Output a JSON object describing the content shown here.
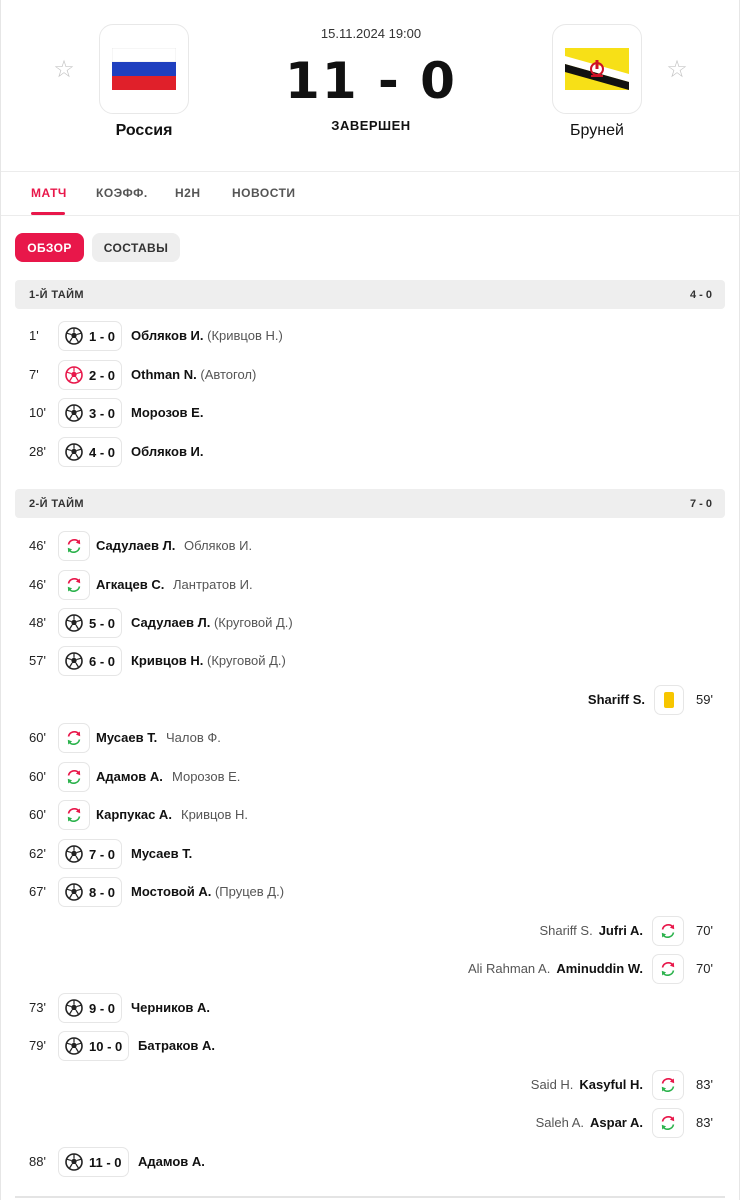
{
  "match": {
    "date": "15.11.2024 19:00",
    "score": "11 - 0",
    "status": "ЗАВЕРШЕН",
    "home": {
      "name": "Россия"
    },
    "away": {
      "name": "Бруней"
    }
  },
  "tabs": [
    {
      "label": "МАТЧ",
      "active": true
    },
    {
      "label": "КОЭФФ.",
      "active": false
    },
    {
      "label": "H2H",
      "active": false
    },
    {
      "label": "НОВОСТИ",
      "active": false
    }
  ],
  "pills": [
    {
      "label": "ОБЗОР",
      "active": true
    },
    {
      "label": "СОСТАВЫ",
      "active": false
    }
  ],
  "halves": [
    {
      "label": "1-Й ТАЙМ",
      "score": "4 - 0"
    },
    {
      "label": "2-Й ТАЙМ",
      "score": "7 - 0"
    }
  ],
  "events": [
    {
      "minute": "1'",
      "type": "goal",
      "side": "home",
      "score": "1 - 0",
      "player": "Обляков И.",
      "assist": "(Кривцов Н.)"
    },
    {
      "minute": "7'",
      "type": "own-goal",
      "side": "home",
      "score": "2 - 0",
      "player": "Othman N.",
      "assist": "(Автогол)"
    },
    {
      "minute": "10'",
      "type": "goal",
      "side": "home",
      "score": "3 - 0",
      "player": "Морозов Е.",
      "assist": ""
    },
    {
      "minute": "28'",
      "type": "goal",
      "side": "home",
      "score": "4 - 0",
      "player": "Обляков И.",
      "assist": ""
    },
    {
      "minute": "46'",
      "type": "sub",
      "side": "home",
      "player": "Садулаев Л.",
      "out": "Обляков И."
    },
    {
      "minute": "46'",
      "type": "sub",
      "side": "home",
      "player": "Агкацев С.",
      "out": "Лантратов И."
    },
    {
      "minute": "48'",
      "type": "goal",
      "side": "home",
      "score": "5 - 0",
      "player": "Садулаев Л.",
      "assist": "(Круговой Д.)"
    },
    {
      "minute": "57'",
      "type": "goal",
      "side": "home",
      "score": "6 - 0",
      "player": "Кривцов Н.",
      "assist": "(Круговой Д.)"
    },
    {
      "minute": "59'",
      "type": "yellow",
      "side": "away",
      "player": "Shariff S.",
      "out": ""
    },
    {
      "minute": "60'",
      "type": "sub",
      "side": "home",
      "player": "Мусаев Т.",
      "out": "Чалов Ф."
    },
    {
      "minute": "60'",
      "type": "sub",
      "side": "home",
      "player": "Адамов А.",
      "out": "Морозов Е."
    },
    {
      "minute": "60'",
      "type": "sub",
      "side": "home",
      "player": "Карпукас А.",
      "out": "Кривцов Н."
    },
    {
      "minute": "62'",
      "type": "goal",
      "side": "home",
      "score": "7 - 0",
      "player": "Мусаев Т.",
      "assist": ""
    },
    {
      "minute": "67'",
      "type": "goal",
      "side": "home",
      "score": "8 - 0",
      "player": "Мостовой А.",
      "assist": "(Пруцев Д.)"
    },
    {
      "minute": "70'",
      "type": "sub",
      "side": "away",
      "player": "Jufri A.",
      "out": "Shariff S."
    },
    {
      "minute": "70'",
      "type": "sub",
      "side": "away",
      "player": "Aminuddin W.",
      "out": "Ali Rahman A."
    },
    {
      "minute": "73'",
      "type": "goal",
      "side": "home",
      "score": "9 - 0",
      "player": "Черников А.",
      "assist": ""
    },
    {
      "minute": "79'",
      "type": "goal",
      "side": "home",
      "score": "10 - 0",
      "player": "Батраков А.",
      "assist": ""
    },
    {
      "minute": "83'",
      "type": "sub",
      "side": "away",
      "player": "Kasyful H.",
      "out": "Said H."
    },
    {
      "minute": "83'",
      "type": "sub",
      "side": "away",
      "player": "Aspar A.",
      "out": "Saleh A."
    },
    {
      "minute": "88'",
      "type": "goal",
      "side": "home",
      "score": "11 - 0",
      "player": "Адамов А.",
      "assist": ""
    }
  ],
  "colors": {
    "accent": "#e8174a",
    "yellow_card": "#f7c600",
    "sub_green": "#2bb24c",
    "sub_red": "#e8174a"
  },
  "icons": {
    "favorite": "star-outline-icon",
    "goal": "soccer-ball-icon",
    "own_goal": "soccer-ball-red-icon",
    "sub": "substitution-arrows-icon",
    "card": "yellow-card-icon"
  }
}
